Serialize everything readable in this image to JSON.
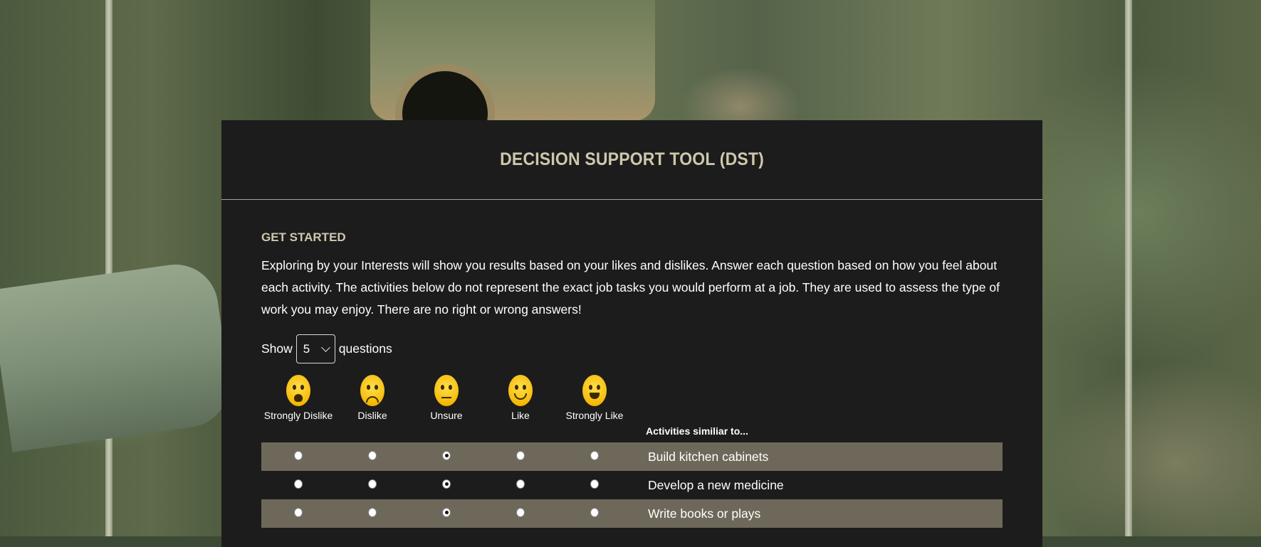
{
  "title": "DECISION SUPPORT TOOL (DST)",
  "get_started": {
    "heading": "GET STARTED",
    "intro": "Exploring by your Interests will show you results based on your likes and dislikes. Answer each question based on how you feel about each activity. The activities below do not represent the exact job tasks you would perform at a job. They are used to assess the type of work you may enjoy. There are no right or wrong answers!"
  },
  "show_control": {
    "prefix": "Show",
    "selected": "5",
    "suffix": "questions"
  },
  "scale": [
    {
      "label": "Strongly Dislike",
      "icon": "very-sad-face-icon"
    },
    {
      "label": "Dislike",
      "icon": "sad-face-icon"
    },
    {
      "label": "Unsure",
      "icon": "neutral-face-icon"
    },
    {
      "label": "Like",
      "icon": "smile-face-icon"
    },
    {
      "label": "Strongly Like",
      "icon": "grin-face-icon"
    }
  ],
  "activities_header": "Activities similiar to...",
  "questions": [
    {
      "label": "Build kitchen cabinets",
      "selected": "Unsure"
    },
    {
      "label": "Develop a new medicine",
      "selected": "Unsure"
    },
    {
      "label": "Write books or plays",
      "selected": "Unsure"
    }
  ],
  "colors": {
    "panel_bg": "#1c1c1c",
    "accent_text": "#cfc7ad",
    "row_shade": "#6d685a",
    "emoji_yellow": "#f4b400"
  }
}
